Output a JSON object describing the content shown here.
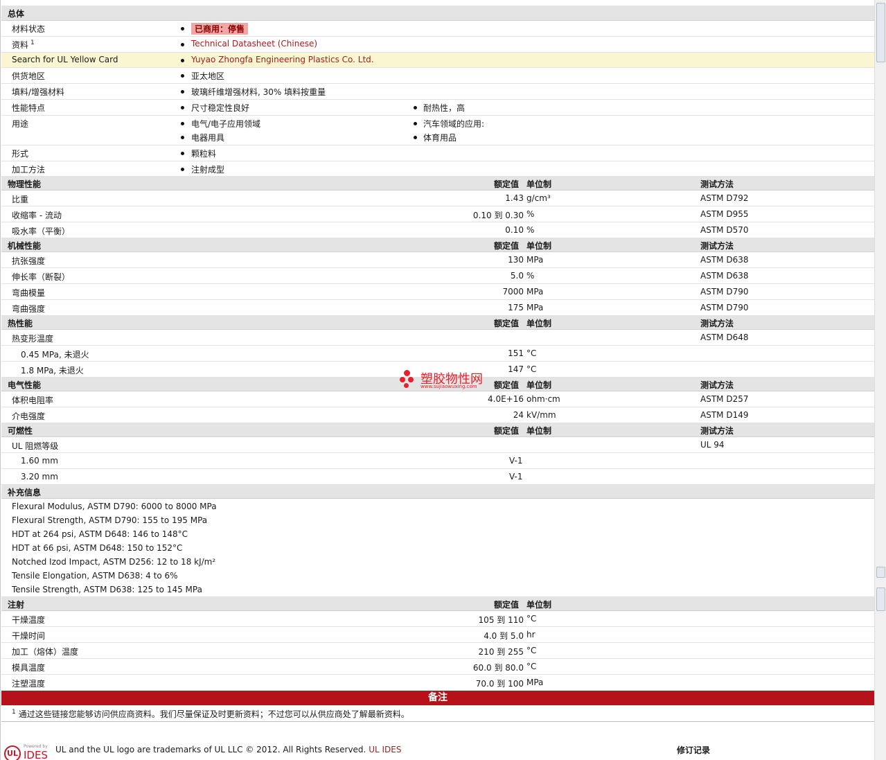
{
  "general": {
    "title": "总体",
    "rows": [
      {
        "label": "材料状态",
        "values": [
          "已商用：停售"
        ]
      },
      {
        "label": "资料",
        "sup": "1",
        "values": [
          "Technical Datasheet (Chinese)"
        ]
      },
      {
        "label": "Search for UL Yellow Card",
        "values": [
          "Yuyao Zhongfa Engineering Plastics Co. Ltd."
        ]
      },
      {
        "label": "供货地区",
        "values": [
          "亚太地区"
        ]
      },
      {
        "label": "填料/增强材料",
        "values": [
          "玻璃纤维增强材料, 30% 填料按重量"
        ]
      },
      {
        "label": "性能特点",
        "values": [
          "尺寸稳定性良好",
          "耐热性，高"
        ]
      },
      {
        "label": "用途",
        "values": [
          "电气/电子应用领域",
          "汽车领域的应用",
          "电器用具",
          "体育用品"
        ]
      },
      {
        "label": "形式",
        "values": [
          "颗粒料"
        ]
      },
      {
        "label": "加工方法",
        "values": [
          "注射成型"
        ]
      }
    ]
  },
  "headers": {
    "nominal": "额定值",
    "unit": "单位制",
    "method": "测试方法"
  },
  "physical": {
    "title": "物理性能",
    "rows": [
      {
        "label": "比重",
        "value": "1.43",
        "unit": "g/cm³",
        "method": "ASTM D792"
      },
      {
        "label": "收缩率  - 流动",
        "value": "0.10 到  0.30",
        "unit": "%",
        "method": "ASTM D955"
      },
      {
        "label": "吸水率（平衡）",
        "value": "0.10",
        "unit": "%",
        "method": "ASTM D570"
      }
    ]
  },
  "mechanical": {
    "title": "机械性能",
    "rows": [
      {
        "label": "抗张强度",
        "value": "130",
        "unit": "MPa",
        "method": "ASTM D638"
      },
      {
        "label": "伸长率（断裂）",
        "value": "5.0",
        "unit": "%",
        "method": "ASTM D638"
      },
      {
        "label": "弯曲模量",
        "value": "7000",
        "unit": "MPa",
        "method": "ASTM D790"
      },
      {
        "label": "弯曲强度",
        "value": "175",
        "unit": "MPa",
        "method": "ASTM D790"
      }
    ]
  },
  "thermal": {
    "title": "热性能",
    "rows": [
      {
        "label": "热变形温度",
        "value": "",
        "unit": "",
        "method": "ASTM D648"
      },
      {
        "label": "0.45 MPa, 未退火",
        "value": "151",
        "unit": "°C",
        "method": ""
      },
      {
        "label": "1.8 MPa, 未退火",
        "value": "147",
        "unit": "°C",
        "method": ""
      }
    ]
  },
  "electrical": {
    "title": "电气性能",
    "rows": [
      {
        "label": "体积电阻率",
        "value": "4.0E+16",
        "unit": "ohm·cm",
        "method": "ASTM D257"
      },
      {
        "label": "介电强度",
        "value": "24",
        "unit": "kV/mm",
        "method": "ASTM D149"
      }
    ]
  },
  "flammability": {
    "title": "可燃性",
    "rows": [
      {
        "label": "UL 阻燃等级",
        "value": "",
        "unit": "",
        "method": "UL 94"
      },
      {
        "label": "1.60 mm",
        "value": "V-1",
        "unit": "",
        "method": ""
      },
      {
        "label": "3.20 mm",
        "value": "V-1",
        "unit": "",
        "method": ""
      }
    ]
  },
  "supplemental": {
    "title": "补充信息",
    "lines": [
      "Flexural Modulus, ASTM D790: 6000 to 8000 MPa",
      "Flexural Strength, ASTM D790: 155 to 195 MPa",
      "HDT at 264 psi, ASTM D648: 146 to 148°C",
      "HDT at 66 psi, ASTM D648: 150 to 152°C",
      "Notched Izod Impact, ASTM D256: 12 to 18 kJ/m²",
      "Tensile Elongation, ASTM D638: 4 to 6%",
      "Tensile Strength, ASTM D638: 125 to 145 MPa"
    ]
  },
  "injection": {
    "title": "注射",
    "rows": [
      {
        "label": "干燥温度",
        "value": "105 到  110",
        "unit": "°C"
      },
      {
        "label": "干燥时间",
        "value": "4.0 到  5.0",
        "unit": "hr"
      },
      {
        "label": "加工（熔体）温度",
        "value": "210 到  255",
        "unit": "°C"
      },
      {
        "label": "模具温度",
        "value": "60.0 到  80.0",
        "unit": "°C"
      },
      {
        "label": "注塑温度",
        "value": "70.0 到  100",
        "unit": "MPa"
      }
    ]
  },
  "notes": {
    "title": "备注",
    "sup": "1",
    "text": "通过这些链接您能够访问供应商资料。我们尽量保证及时更新资料；不过您可以从供应商处了解最新资料。"
  },
  "watermark": {
    "name": "塑胶物性网",
    "url": "www.sujiaowuxing.com"
  },
  "footer": {
    "powered": "Powered by",
    "ul": "UL",
    "ides": "IDES",
    "trademark": "UL and the UL logo are trademarks of UL LLC © 2012. All Rights Reserved.",
    "ides_link": "UL IDES",
    "revision_title": "修订记录"
  }
}
